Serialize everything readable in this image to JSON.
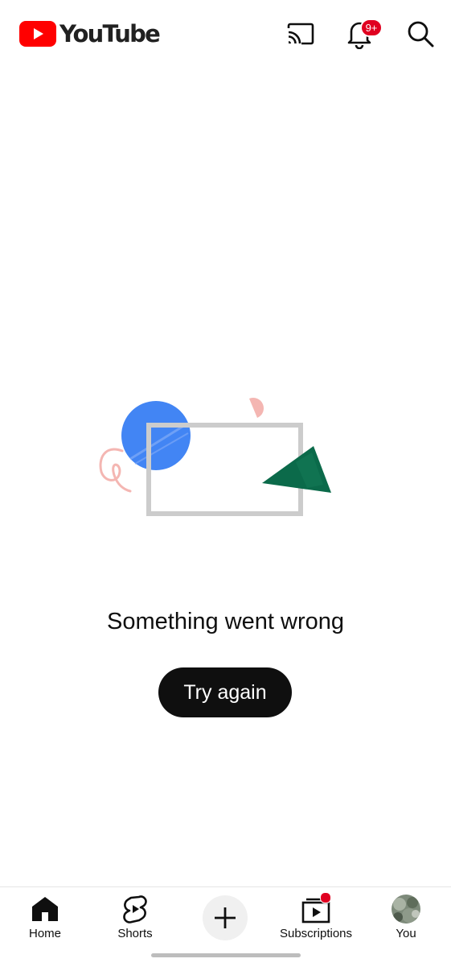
{
  "app": {
    "logo_text": "YouTube",
    "brand_color": "#ff0000"
  },
  "header": {
    "icons": [
      "cast-icon",
      "notifications-bell-icon",
      "search-icon"
    ],
    "notification_badge": "9+"
  },
  "error": {
    "message": "Something went wrong",
    "retry_label": "Try again",
    "illustration_colors": {
      "circle": "#4285f4",
      "frame": "#cccccc",
      "triangle": "#0b6a4a",
      "squiggle": "#f4b6b2"
    }
  },
  "bottom_nav": {
    "items": [
      {
        "label": "Home",
        "icon": "home-icon",
        "selected": true
      },
      {
        "label": "Shorts",
        "icon": "shorts-icon",
        "selected": false
      },
      {
        "label": "",
        "icon": "create-plus-icon",
        "selected": false
      },
      {
        "label": "Subscriptions",
        "icon": "subscriptions-icon",
        "selected": false,
        "has_new_dot": true
      },
      {
        "label": "You",
        "icon": "avatar",
        "selected": false
      }
    ],
    "accent_color": "#e00020"
  }
}
